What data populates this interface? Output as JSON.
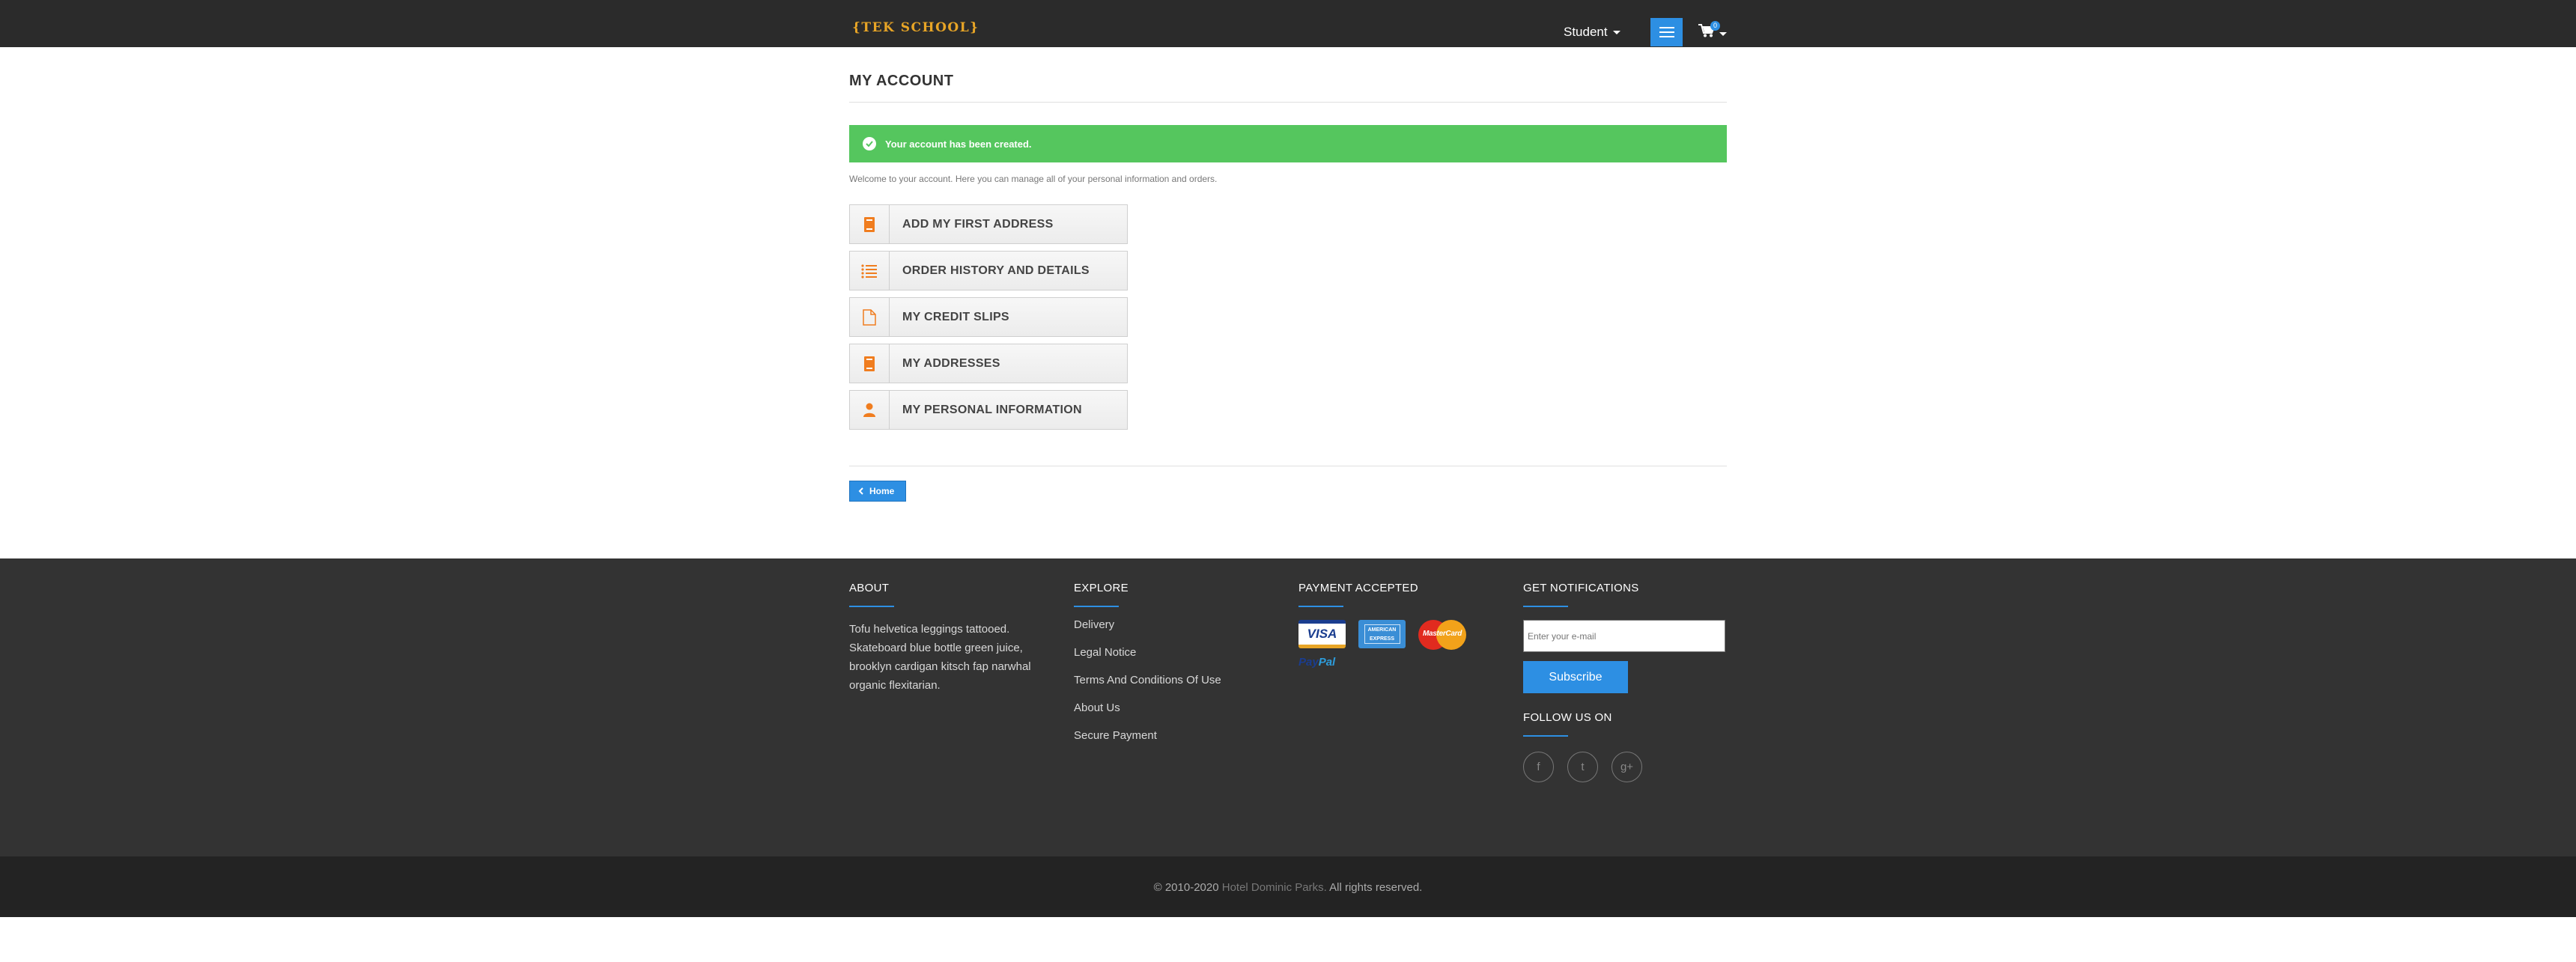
{
  "header": {
    "logo": "{TEK SCHOOL}",
    "user_label": "Student",
    "cart_count": "0"
  },
  "main": {
    "title": "MY ACCOUNT",
    "alert": "Your account has been created.",
    "welcome": "Welcome to your account. Here you can manage all of your personal information and orders.",
    "items": [
      {
        "label": "ADD MY FIRST ADDRESS",
        "icon": "address-book-icon"
      },
      {
        "label": "ORDER HISTORY AND DETAILS",
        "icon": "list-icon"
      },
      {
        "label": "MY CREDIT SLIPS",
        "icon": "document-icon"
      },
      {
        "label": "MY ADDRESSES",
        "icon": "address-book-icon"
      },
      {
        "label": "MY PERSONAL INFORMATION",
        "icon": "user-icon"
      }
    ],
    "home_label": "Home"
  },
  "footer": {
    "about": {
      "heading": "ABOUT",
      "text": "Tofu helvetica leggings tattooed. Skateboard blue bottle green juice, brooklyn cardigan kitsch fap narwhal organic flexitarian."
    },
    "explore": {
      "heading": "EXPLORE",
      "links": [
        "Delivery",
        "Legal Notice",
        "Terms And Conditions Of Use",
        "About Us",
        "Secure Payment"
      ]
    },
    "payment": {
      "heading": "PAYMENT ACCEPTED",
      "visa": "VISA",
      "amex": "AMERICAN EXPRESS",
      "mastercard": "MasterCard",
      "paypal_a": "Pay",
      "paypal_b": "Pal"
    },
    "notifications": {
      "heading": "GET NOTIFICATIONS",
      "placeholder": "Enter your e-mail",
      "subscribe_label": "Subscribe",
      "follow_heading": "FOLLOW US ON",
      "social": [
        "f",
        "t",
        "g+"
      ]
    },
    "copyright_prefix": "© 2010-2020 ",
    "copyright_brand": "Hotel Dominic Parks.",
    "copyright_suffix": " All rights reserved."
  },
  "colors": {
    "accent": "#2d8fe3",
    "success": "#55c65e",
    "icon": "#f07d1f",
    "logo": "#e8a526"
  }
}
